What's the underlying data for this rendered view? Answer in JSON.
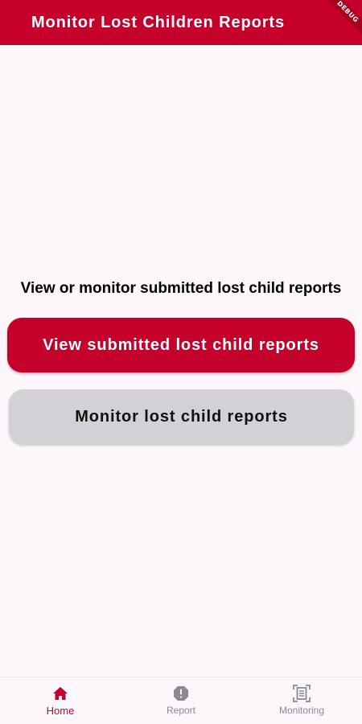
{
  "app_bar": {
    "title": "Monitor Lost Children Reports",
    "debug_label": "DEBUG",
    "color": "#c4002b"
  },
  "main": {
    "prompt": "View or monitor submitted lost child reports",
    "view_button_label": "View submitted lost child reports",
    "monitor_button_label": "Monitor lost child reports"
  },
  "bottom_nav": {
    "items": [
      {
        "label": "Home",
        "icon": "home-icon",
        "active": true
      },
      {
        "label": "Report",
        "icon": "alert-octagon-icon",
        "active": false
      },
      {
        "label": "Monitoring",
        "icon": "document-scan-icon",
        "active": false
      }
    ],
    "active_color": "#c4002b",
    "inactive_color": "#8a8a8f"
  }
}
